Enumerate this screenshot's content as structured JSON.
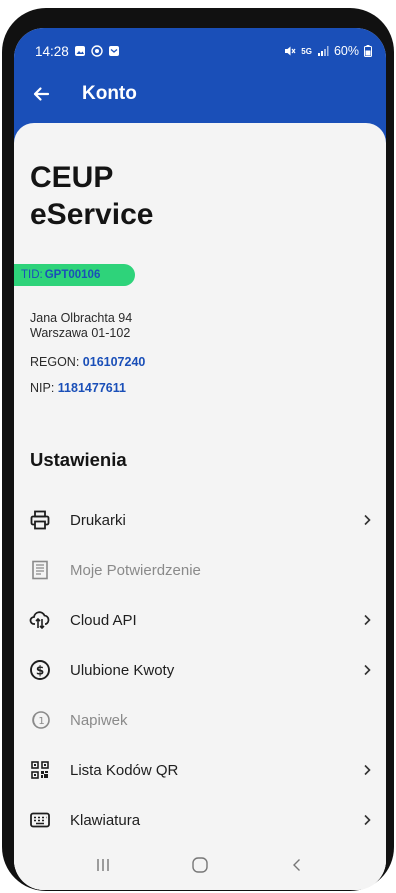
{
  "status_bar": {
    "time": "14:28",
    "battery": "60%",
    "network": "5G"
  },
  "app_bar": {
    "title": "Konto"
  },
  "merchant": {
    "name_line1": "CEUP",
    "name_line2": "eService",
    "tid_label": "TID:",
    "tid_value": "GPT00106",
    "address_line1": "Jana Olbrachta 94",
    "address_line2": "Warszawa 01-102",
    "regon_label": "REGON:",
    "regon_value": "016107240",
    "nip_label": "NIP:",
    "nip_value": "1181477611"
  },
  "settings": {
    "title": "Ustawienia",
    "items": [
      {
        "label": "Drukarki",
        "icon": "printer-icon",
        "enabled": true
      },
      {
        "label": "Moje Potwierdzenie",
        "icon": "receipt-icon",
        "enabled": false
      },
      {
        "label": "Cloud API",
        "icon": "cloud-sync-icon",
        "enabled": true
      },
      {
        "label": "Ulubione Kwoty",
        "icon": "dollar-circle-icon",
        "enabled": true
      },
      {
        "label": "Napiwek",
        "icon": "coin-icon",
        "enabled": false
      },
      {
        "label": "Lista Kodów QR",
        "icon": "qr-code-icon",
        "enabled": true
      },
      {
        "label": "Klawiatura",
        "icon": "keyboard-icon",
        "enabled": true
      }
    ]
  },
  "colors": {
    "primary": "#1a4fb8",
    "badge": "#2ed37a",
    "background": "#f4f4f4",
    "disabled": "#8a8a8a"
  }
}
